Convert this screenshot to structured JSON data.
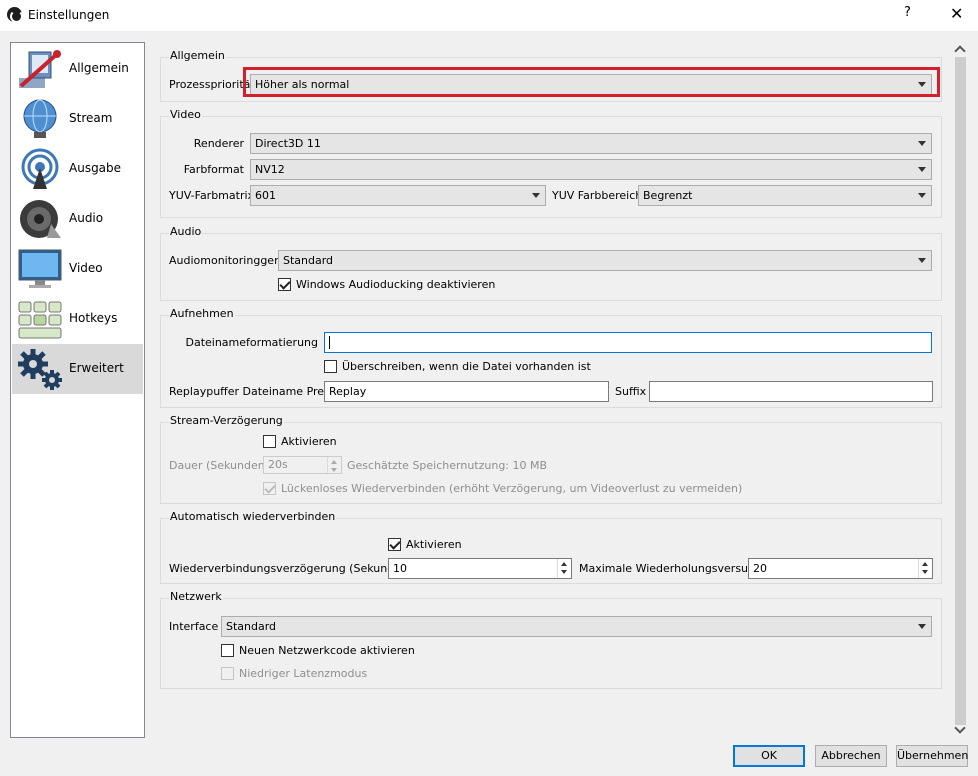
{
  "window": {
    "title": "Einstellungen",
    "help": "?",
    "close": "✕"
  },
  "sidebar": {
    "items": [
      {
        "label": "Allgemein",
        "icon": "wrench-icon"
      },
      {
        "label": "Stream",
        "icon": "globe-icon"
      },
      {
        "label": "Ausgabe",
        "icon": "broadcast-icon"
      },
      {
        "label": "Audio",
        "icon": "speaker-icon"
      },
      {
        "label": "Video",
        "icon": "monitor-icon"
      },
      {
        "label": "Hotkeys",
        "icon": "keyboard-icon"
      },
      {
        "label": "Erweitert",
        "icon": "gears-icon",
        "selected": true
      }
    ]
  },
  "general": {
    "title": "Allgemein",
    "priority_label": "Prozesspriorität",
    "priority_value": "Höher als normal"
  },
  "video": {
    "title": "Video",
    "renderer_label": "Renderer",
    "renderer_value": "Direct3D 11",
    "format_label": "Farbformat",
    "format_value": "NV12",
    "matrix_label": "YUV-Farbmatrix",
    "matrix_value": "601",
    "range_label": "YUV Farbbereich",
    "range_value": "Begrenzt"
  },
  "audio": {
    "title": "Audio",
    "monitor_label": "Audiomonitoringgerät",
    "monitor_value": "Standard",
    "ducking_label": "Windows Audioducking deaktivieren",
    "ducking_checked": true
  },
  "recording": {
    "title": "Aufnehmen",
    "filename_label": "Dateinameformatierung",
    "filename_value": "",
    "overwrite_label": "Überschreiben, wenn die Datei vorhanden ist",
    "overwrite_checked": false,
    "replay_prefix_label": "Replaypuffer Dateiname Prefix",
    "replay_prefix_value": "Replay",
    "suffix_label": "Suffix",
    "suffix_value": ""
  },
  "stream_delay": {
    "title": "Stream-Verzögerung",
    "enable_label": "Aktivieren",
    "enable_checked": false,
    "duration_label": "Dauer (Sekunden)",
    "duration_value": "20s",
    "memory_label": "Geschätzte Speichernutzung: 10 MB",
    "preserve_label": "Lückenloses Wiederverbinden (erhöht Verzögerung, um Videoverlust zu vermeiden)",
    "preserve_checked": true
  },
  "reconnect": {
    "title": "Automatisch wiederverbinden",
    "enable_label": "Aktivieren",
    "enable_checked": true,
    "delay_label": "Wiederverbindungsverzögerung (Sekunden)",
    "delay_value": "10",
    "retries_label": "Maximale Wiederholungsversuche",
    "retries_value": "20"
  },
  "network": {
    "title": "Netzwerk",
    "interface_label": "Interface",
    "interface_value": "Standard",
    "new_code_label": "Neuen Netzwerkcode aktivieren",
    "new_code_checked": false,
    "low_latency_label": "Niedriger Latenzmodus",
    "low_latency_checked": false
  },
  "buttons": {
    "ok": "OK",
    "cancel": "Abbrechen",
    "apply": "Übernehmen"
  },
  "colors": {
    "highlight": "#d4202b",
    "selected_item": "#d9d9d9",
    "focus": "#0078d7"
  }
}
